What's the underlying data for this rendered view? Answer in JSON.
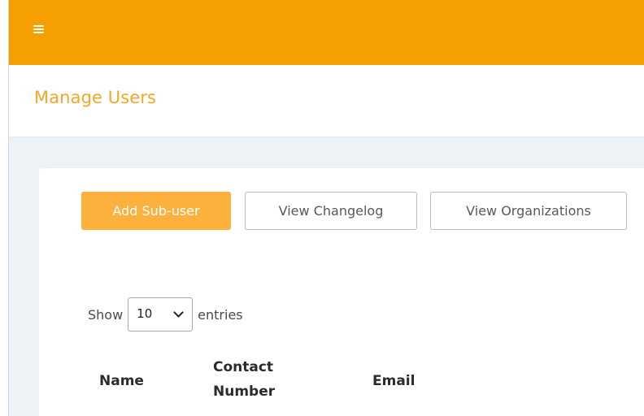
{
  "header": {
    "menu_icon": "hamburger-menu-icon",
    "bar_color": "#f5a000"
  },
  "page": {
    "title": "Manage Users",
    "title_color": "#f5a623"
  },
  "actions": {
    "add_sub_user": "Add Sub-user",
    "view_changelog": "View Changelog",
    "view_organizations": "View Organizations",
    "primary_color": "#fbb13c"
  },
  "length_menu": {
    "prefix": "Show",
    "selected": "10",
    "suffix": "entries",
    "arrow_icon": "chevron-down-icon"
  },
  "table": {
    "columns": [
      "Name",
      "Contact Number",
      "Email"
    ]
  }
}
